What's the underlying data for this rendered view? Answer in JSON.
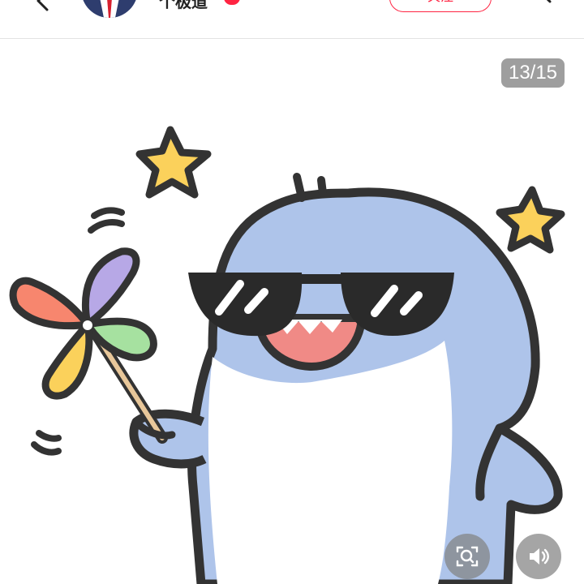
{
  "header": {
    "author_name": "个极道",
    "follow_label": "关注",
    "back_icon": "chevron-left-icon",
    "share_icon": "share-icon",
    "avatar_icon": "avatar",
    "badge_icon": "verified-badge-icon"
  },
  "viewer": {
    "page_counter": "13/15",
    "current_page": 13,
    "total_pages": 15,
    "image": "shark-with-sunglasses-and-pinwheel-sticker",
    "scan_icon": "image-search-icon",
    "sound_icon": "speaker-icon"
  },
  "colors": {
    "accent": "#ff2442",
    "shark_body": "#aec4ea",
    "outline": "#333333",
    "star": "#fbd15b",
    "mouth": "#f08a86"
  }
}
